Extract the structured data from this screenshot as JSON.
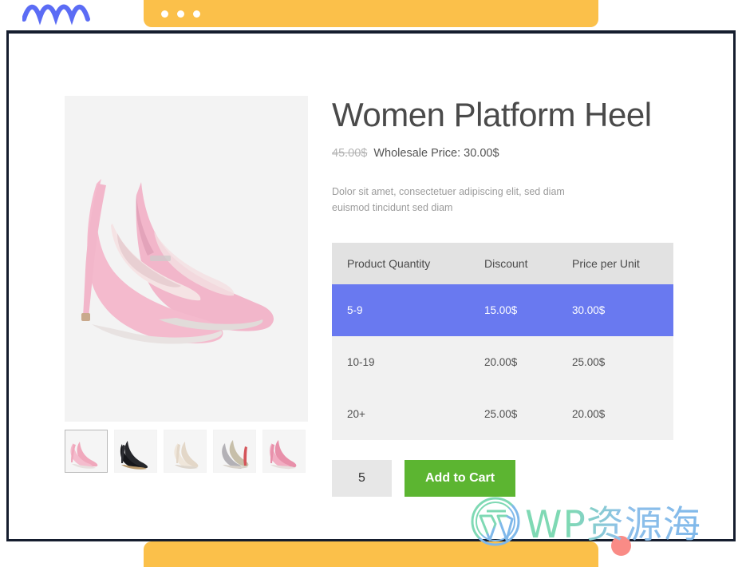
{
  "browser_chrome": {
    "dots": [
      "dot-red",
      "dot-yellow",
      "dot-green"
    ],
    "bar_color": "#fbc04a"
  },
  "decor": {
    "wave_icon": "blue-wave-icon",
    "wave_color": "#5b6cf5",
    "bottom_dot_color": "#f98b86"
  },
  "product": {
    "title": "Women Platform Heel",
    "price_old": "45.00$",
    "price_new": "Wholesale Price: 30.00$",
    "description": "Dolor sit amet, consectetuer adipiscing elit, sed diam euismod tincidunt sed diam",
    "hero_alt": "pink-suede-platform-heels",
    "thumbnails": [
      {
        "name": "thumb-pink-heels",
        "selected": true,
        "color": "#f0a8bc"
      },
      {
        "name": "thumb-black-heels",
        "selected": false,
        "color": "#1c1c1c"
      },
      {
        "name": "thumb-cream-heels",
        "selected": false,
        "color": "#ddd2c4"
      },
      {
        "name": "thumb-silver-heels",
        "selected": false,
        "color": "#a9a7ab"
      },
      {
        "name": "thumb-pink-heels-alt",
        "selected": false,
        "color": "#eb9fb4"
      }
    ]
  },
  "pricing_table": {
    "headers": [
      "Product Quantity",
      "Discount",
      "Price per Unit"
    ],
    "rows": [
      {
        "quantity": "5-9",
        "discount": "15.00$",
        "price": "30.00$",
        "active": true
      },
      {
        "quantity": "10-19",
        "discount": "20.00$",
        "price": "25.00$",
        "active": false
      },
      {
        "quantity": "20+",
        "discount": "25.00$",
        "price": "20.00$",
        "active": false
      }
    ],
    "header_bg": "#e2e2e2",
    "row_bg": "#f1f1f1",
    "active_bg": "#6979f0"
  },
  "cart": {
    "quantity_value": "5",
    "quantity_placeholder": "1",
    "add_to_cart_label": "Add to Cart",
    "button_color": "#5cb531"
  },
  "watermark": {
    "logo": "wordpress-logo-icon",
    "text": "WP资源海"
  }
}
